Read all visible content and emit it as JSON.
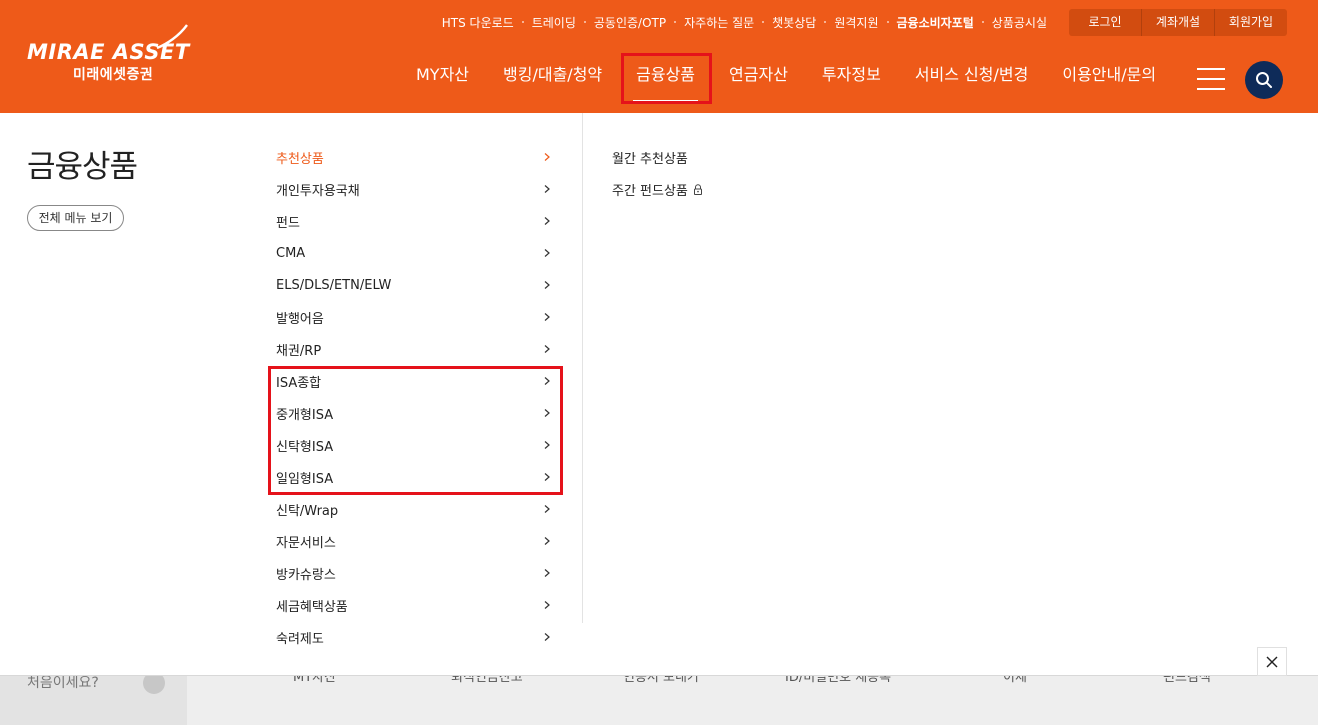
{
  "logo": {
    "text": "MIRAE ASSET",
    "sub": "미래에셋증권"
  },
  "utility_links": [
    {
      "label": "HTS 다운로드",
      "bold": false
    },
    {
      "label": "트레이딩",
      "bold": false
    },
    {
      "label": "공동인증/OTP",
      "bold": false
    },
    {
      "label": "자주하는 질문",
      "bold": false
    },
    {
      "label": "챗봇상담",
      "bold": false
    },
    {
      "label": "원격지원",
      "bold": false
    },
    {
      "label": "금융소비자포털",
      "bold": true
    },
    {
      "label": "상품공시실",
      "bold": false
    }
  ],
  "auth_buttons": [
    "로그인",
    "계좌개설",
    "회원가입"
  ],
  "gnb": [
    {
      "label": "MY자산",
      "active": false
    },
    {
      "label": "뱅킹/대출/청약",
      "active": false
    },
    {
      "label": "금융상품",
      "active": true
    },
    {
      "label": "연금자산",
      "active": false
    },
    {
      "label": "투자정보",
      "active": false
    },
    {
      "label": "서비스 신청/변경",
      "active": false
    },
    {
      "label": "이용안내/문의",
      "active": false
    }
  ],
  "page_title": "금융상품",
  "all_menu_label": "전체 메뉴 보기",
  "menu": [
    {
      "label": "추천상품",
      "active": true
    },
    {
      "label": "개인투자용국채",
      "active": false
    },
    {
      "label": "펀드",
      "active": false
    },
    {
      "label": "CMA",
      "active": false
    },
    {
      "label": "ELS/DLS/ETN/ELW",
      "active": false
    },
    {
      "label": "발행어음",
      "active": false
    },
    {
      "label": "채권/RP",
      "active": false
    },
    {
      "label": "ISA종합",
      "active": false
    },
    {
      "label": "중개형ISA",
      "active": false
    },
    {
      "label": "신탁형ISA",
      "active": false
    },
    {
      "label": "일임형ISA",
      "active": false
    },
    {
      "label": "신탁/Wrap",
      "active": false
    },
    {
      "label": "자문서비스",
      "active": false
    },
    {
      "label": "방카슈랑스",
      "active": false
    },
    {
      "label": "세금혜택상품",
      "active": false
    },
    {
      "label": "숙려제도",
      "active": false
    }
  ],
  "submenu": [
    {
      "label": "월간 추천상품",
      "locked": false
    },
    {
      "label": "주간 펀드상품",
      "locked": true
    }
  ],
  "quickbar": {
    "first_label": "처음이세요?",
    "links": [
      "MY자산",
      "퇴직연금잔고",
      "인증서 보내기",
      "ID/비밀번호 재등록",
      "이체",
      "펀드검색"
    ]
  },
  "colors": {
    "brand_orange": "#ee5a19",
    "search_navy": "#0e2b59",
    "highlight_red": "#e5121a"
  }
}
